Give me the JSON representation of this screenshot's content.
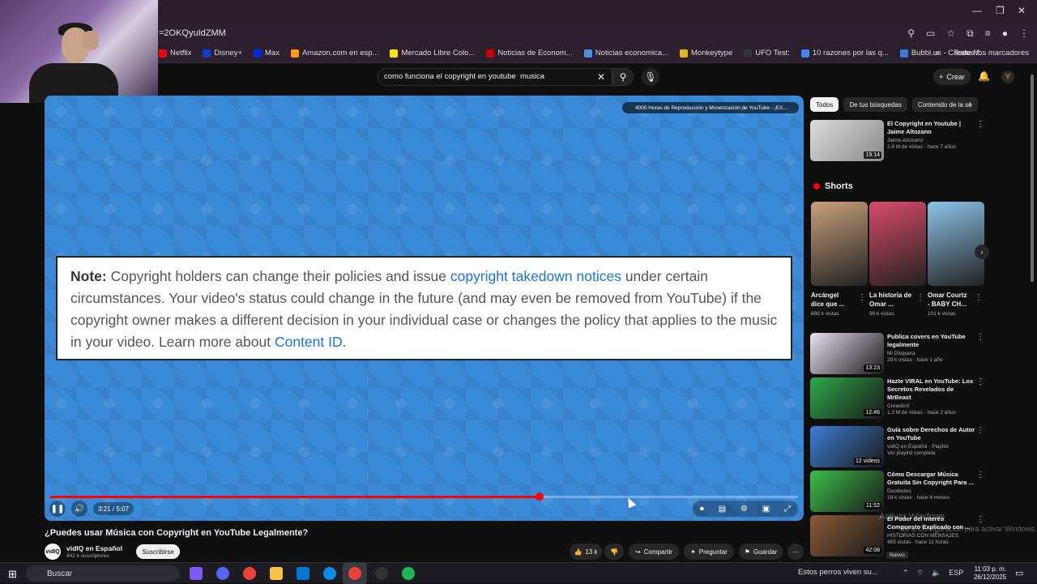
{
  "browser": {
    "url_fragment": "=2OKQyuIdZMM",
    "bookmarks": [
      "Netflix",
      "Disney+",
      "Max",
      "Amazon.com en esp...",
      "Mercado Libre Colo...",
      "Noticias de Econom...",
      "Noticias economica...",
      "Monkeytype",
      "UFO Test:",
      "10 razones por las q...",
      "Bubbl.us - Create M..."
    ],
    "all_bookmarks": "Todos los marcadores"
  },
  "header": {
    "search_value": "como funciona el copyright en youtube  musica",
    "create_label": "Crear",
    "avatar_letter": "Y"
  },
  "player": {
    "card_title": "4000 Horas de Reproducción y Monetización de YouTube - ¡EX...",
    "note_label": "Note:",
    "note_part1": " Copyright holders can change their policies and issue ",
    "note_link1": "copyright takedown notices",
    "note_part2": " under certain circumstances. Your video's status could change in the future (and may even be removed from YouTube) if the copyright owner makes a different decision in your individual case or changes the policy that applies to the music in your video. Learn more about ",
    "note_link2": "Content ID",
    "note_end": ".",
    "time": "3:21 / 5:07",
    "progress": 0.654
  },
  "video": {
    "title": "¿Puedes usar Música con Copyright en YouTube Legalmente?",
    "channel": "vidIQ en Español",
    "subs": "442 k suscriptores",
    "subscribe": "Suscribirse",
    "likes": "13 k",
    "share": "Compartir",
    "ask": "Preguntar",
    "save": "Guardar"
  },
  "sidebar": {
    "chips": [
      "Todos",
      "De tus búsquedas",
      "Contenido de la se"
    ],
    "shorts_label": "Shorts",
    "top": {
      "title": "El Copyright en Youtube | Jaime Altozano",
      "channel": "Jaime Altozano",
      "views": "2.6 M de vistas · hace 7 años",
      "dur": "19:14"
    },
    "shorts": [
      {
        "title": "Arcángel dice que ...",
        "views": "688 k vistas",
        "color": "#c8a07a"
      },
      {
        "title": "La historia de Omar ...",
        "views": "99 k vistas",
        "color": "#d84a6a"
      },
      {
        "title": "Omar Courtz - BABY CH...",
        "views": "101 k vistas",
        "color": "#8cc4e8"
      }
    ],
    "videos": [
      {
        "title": "Publica covers en YouTube legalmente",
        "channel": "Mi Disquera",
        "views": "29 k vistas · hace 1 año",
        "dur": "13:23",
        "color": "#e9e1f0"
      },
      {
        "title": "Hazte VIRAL en YouTube: Los Secretos Revelados de MrBeast",
        "channel": "CreadorX",
        "views": "1.3 M de vistas · hace 2 años",
        "dur": "12:46",
        "color": "#2fa84a"
      },
      {
        "title": "Guía sobre Derechos de Autor en YouTube",
        "channel": "vidIQ en Español · Playlist",
        "views": "Ver playlist completa",
        "dur": "12 videos",
        "color": "#3d7fd6"
      },
      {
        "title": "Cómo Descargar Música Gratuita Sin Copyright Para ...",
        "channel": "Duodedos",
        "views": "18 k vistas · hace 4 meses",
        "dur": "11:52",
        "color": "#3cbf4a"
      },
      {
        "title": "El Poder del Interés Compuesto Explicado con ...",
        "channel": "HISTORIAS CON MENSAJES",
        "views": "455 vistas · hace 11 horas",
        "dur": "42:08",
        "color": "#8a5a3a"
      }
    ],
    "new_badge": "Nuevo"
  },
  "overlay": {
    "watermark": "Activar Windows",
    "watermark2": "Ve a Configuración para activar Windows."
  },
  "taskbar": {
    "search": "Buscar",
    "media": "Estos perros viven su...",
    "lang": "ESP",
    "time": "11:03 p. m.",
    "date": "26/12/2025"
  }
}
